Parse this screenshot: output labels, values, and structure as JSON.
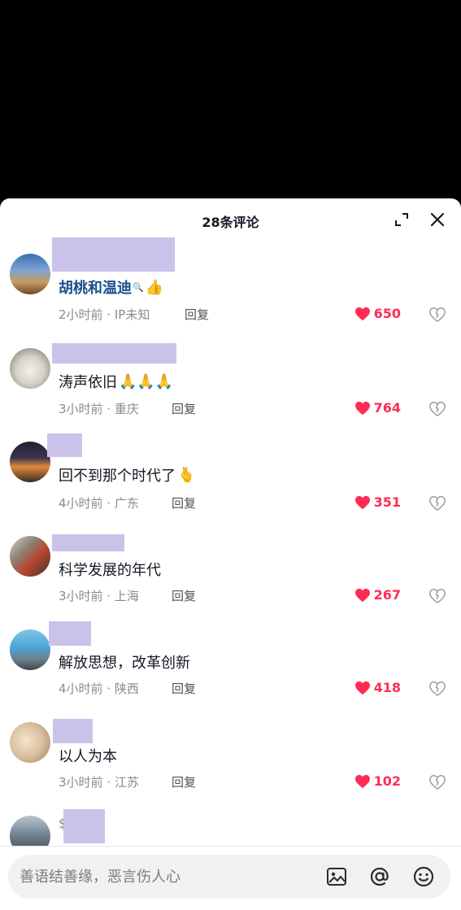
{
  "header": {
    "title": "28条评论"
  },
  "comments": [
    {
      "text": "胡桃和温迪",
      "suffix": "🔍",
      "emoji": "👍",
      "time": "2小时前 · IP未知",
      "reply": "回复",
      "likes": "650"
    },
    {
      "text": "涛声依旧",
      "emoji": "🙏🙏🙏",
      "time": "3小时前 · 重庆",
      "reply": "回复",
      "likes": "764"
    },
    {
      "text": "回不到那个时代了",
      "emoji": "🫰",
      "time": "4小时前 · 广东",
      "reply": "回复",
      "likes": "351"
    },
    {
      "text": "科学发展的年代",
      "time": "3小时前 · 上海",
      "reply": "回复",
      "likes": "267"
    },
    {
      "text": "解放思想，改革创新",
      "time": "4小时前 · 陕西",
      "reply": "回复",
      "likes": "418"
    },
    {
      "text": "以人为本",
      "time": "3小时前 · 江苏",
      "reply": "回复",
      "likes": "102"
    }
  ],
  "partial_comment": {
    "visible_char": "$"
  },
  "input": {
    "placeholder": "善语结善缘，恶言伤人心"
  },
  "icons": {
    "expand": "expand-icon",
    "close": "close-icon",
    "like": "heart-icon",
    "dislike": "broken-heart-icon",
    "image": "image-icon",
    "mention": "at-icon",
    "emoji": "emoji-icon"
  },
  "colors": {
    "like": "#fe2c55",
    "redaction": "#cbc2ea",
    "link": "#1a4e8c"
  }
}
